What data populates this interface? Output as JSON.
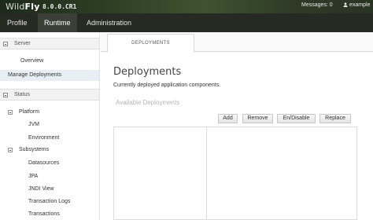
{
  "header": {
    "logo_prefix": "Wild",
    "logo_suffix": "Fly",
    "version": "8.0.0.CR1",
    "messages_label": "Messages: 0",
    "user_label": "example"
  },
  "mainnav": {
    "tabs": [
      {
        "label": "Profile"
      },
      {
        "label": "Runtime"
      },
      {
        "label": "Administration"
      }
    ],
    "active": "Runtime"
  },
  "sidebar": {
    "server": {
      "title": "Server",
      "items": [
        {
          "label": "Overview"
        },
        {
          "label": "Manage Deployments"
        }
      ]
    },
    "status": {
      "title": "Status",
      "platform": {
        "label": "Platform",
        "items": [
          {
            "label": "JVM"
          },
          {
            "label": "Environment"
          }
        ]
      },
      "subsystems": {
        "label": "Subsystems",
        "items": [
          {
            "label": "Datasources"
          },
          {
            "label": "JPA"
          },
          {
            "label": "JNDI View"
          },
          {
            "label": "Transaction Logs"
          },
          {
            "label": "Transactions"
          }
        ]
      }
    }
  },
  "main": {
    "tab_label": "DEPLOYMENTS",
    "title": "Deployments",
    "description": "Currently deployed application components.",
    "available_label": "Available Deployments",
    "buttons": {
      "add": "Add",
      "remove": "Remove",
      "endisable": "En/Disable",
      "replace": "Replace"
    }
  }
}
